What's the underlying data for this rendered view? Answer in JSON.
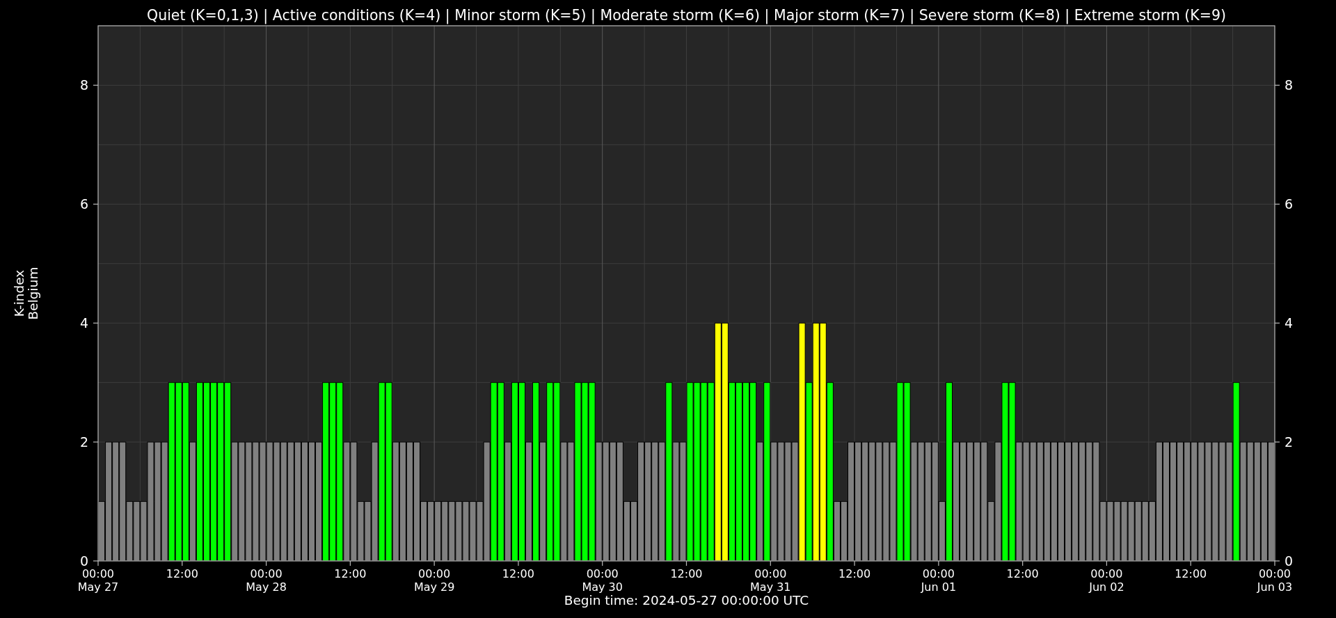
{
  "chart_data": {
    "type": "bar",
    "title": "Quiet (K=0,1,3) | Active conditions (K=4) | Minor storm (K=5) | Moderate storm (K=6) | Major storm (K=7) | Severe storm (K=8) | Extreme storm (K=9)",
    "xlabel": "Begin time: 2024-05-27 00:00:00 UTC",
    "ylabel": "K-index\nBelgium",
    "xlim": [
      "2024-05-27T00:00Z",
      "2024-06-03T00:00Z"
    ],
    "ylim": [
      0,
      9
    ],
    "yticks": [
      0,
      2,
      4,
      6,
      8
    ],
    "y2lim": [
      0,
      9
    ],
    "y2ticks": [
      0,
      2,
      4,
      6,
      8
    ],
    "grid": true,
    "xticks": [
      {
        "value": "2024-05-27T00:00Z",
        "label": "00:00\nMay 27"
      },
      {
        "value": "2024-05-27T12:00Z",
        "label": "12:00"
      },
      {
        "value": "2024-05-28T00:00Z",
        "label": "00:00\nMay 28"
      },
      {
        "value": "2024-05-28T12:00Z",
        "label": "12:00"
      },
      {
        "value": "2024-05-29T00:00Z",
        "label": "00:00\nMay 29"
      },
      {
        "value": "2024-05-29T12:00Z",
        "label": "12:00"
      },
      {
        "value": "2024-05-30T00:00Z",
        "label": "00:00\nMay 30"
      },
      {
        "value": "2024-05-30T12:00Z",
        "label": "12:00"
      },
      {
        "value": "2024-05-31T00:00Z",
        "label": "00:00\nMay 31"
      },
      {
        "value": "2024-05-31T12:00Z",
        "label": "12:00"
      },
      {
        "value": "2024-06-01T00:00Z",
        "label": "00:00\nJun 01"
      },
      {
        "value": "2024-06-01T12:00Z",
        "label": "12:00"
      },
      {
        "value": "2024-06-02T00:00Z",
        "label": "00:00\nJun 02"
      },
      {
        "value": "2024-06-02T12:00Z",
        "label": "12:00"
      },
      {
        "value": "2024-06-03T00:00Z",
        "label": "00:00\nJun 03"
      }
    ],
    "x": [
      "2024-05-27T00:00Z",
      "2024-05-27T01:00Z",
      "2024-05-27T02:00Z",
      "2024-05-27T03:00Z",
      "2024-05-27T04:00Z",
      "2024-05-27T05:00Z",
      "2024-05-27T06:00Z",
      "2024-05-27T07:00Z",
      "2024-05-27T08:00Z",
      "2024-05-27T09:00Z",
      "2024-05-27T10:00Z",
      "2024-05-27T11:00Z",
      "2024-05-27T12:00Z",
      "2024-05-27T13:00Z",
      "2024-05-27T14:00Z",
      "2024-05-27T15:00Z",
      "2024-05-27T16:00Z",
      "2024-05-27T17:00Z",
      "2024-05-27T18:00Z",
      "2024-05-27T19:00Z",
      "2024-05-27T20:00Z",
      "2024-05-27T21:00Z",
      "2024-05-27T22:00Z",
      "2024-05-27T23:00Z",
      "2024-05-28T00:00Z",
      "2024-05-28T01:00Z",
      "2024-05-28T02:00Z",
      "2024-05-28T03:00Z",
      "2024-05-28T04:00Z",
      "2024-05-28T05:00Z",
      "2024-05-28T06:00Z",
      "2024-05-28T07:00Z",
      "2024-05-28T08:00Z",
      "2024-05-28T09:00Z",
      "2024-05-28T10:00Z",
      "2024-05-28T11:00Z",
      "2024-05-28T12:00Z",
      "2024-05-28T13:00Z",
      "2024-05-28T14:00Z",
      "2024-05-28T15:00Z",
      "2024-05-28T16:00Z",
      "2024-05-28T17:00Z",
      "2024-05-28T18:00Z",
      "2024-05-28T19:00Z",
      "2024-05-28T20:00Z",
      "2024-05-28T21:00Z",
      "2024-05-28T22:00Z",
      "2024-05-28T23:00Z",
      "2024-05-29T00:00Z",
      "2024-05-29T01:00Z",
      "2024-05-29T02:00Z",
      "2024-05-29T03:00Z",
      "2024-05-29T04:00Z",
      "2024-05-29T05:00Z",
      "2024-05-29T06:00Z",
      "2024-05-29T07:00Z",
      "2024-05-29T08:00Z",
      "2024-05-29T09:00Z",
      "2024-05-29T10:00Z",
      "2024-05-29T11:00Z",
      "2024-05-29T12:00Z",
      "2024-05-29T13:00Z",
      "2024-05-29T14:00Z",
      "2024-05-29T15:00Z",
      "2024-05-29T16:00Z",
      "2024-05-29T17:00Z",
      "2024-05-29T18:00Z",
      "2024-05-29T19:00Z",
      "2024-05-29T20:00Z",
      "2024-05-29T21:00Z",
      "2024-05-29T22:00Z",
      "2024-05-29T23:00Z",
      "2024-05-30T00:00Z",
      "2024-05-30T01:00Z",
      "2024-05-30T02:00Z",
      "2024-05-30T03:00Z",
      "2024-05-30T04:00Z",
      "2024-05-30T05:00Z",
      "2024-05-30T06:00Z",
      "2024-05-30T07:00Z",
      "2024-05-30T08:00Z",
      "2024-05-30T09:00Z",
      "2024-05-30T10:00Z",
      "2024-05-30T11:00Z",
      "2024-05-30T12:00Z",
      "2024-05-30T13:00Z",
      "2024-05-30T14:00Z",
      "2024-05-30T15:00Z",
      "2024-05-30T16:00Z",
      "2024-05-30T17:00Z",
      "2024-05-30T18:00Z",
      "2024-05-30T19:00Z",
      "2024-05-30T20:00Z",
      "2024-05-30T21:00Z",
      "2024-05-30T22:00Z",
      "2024-05-30T23:00Z",
      "2024-05-31T00:00Z",
      "2024-05-31T01:00Z",
      "2024-05-31T02:00Z",
      "2024-05-31T03:00Z",
      "2024-05-31T04:00Z",
      "2024-05-31T05:00Z",
      "2024-05-31T06:00Z",
      "2024-05-31T07:00Z",
      "2024-05-31T08:00Z",
      "2024-05-31T09:00Z",
      "2024-05-31T10:00Z",
      "2024-05-31T11:00Z",
      "2024-05-31T12:00Z",
      "2024-05-31T13:00Z",
      "2024-05-31T14:00Z",
      "2024-05-31T15:00Z",
      "2024-05-31T16:00Z",
      "2024-05-31T17:00Z",
      "2024-05-31T18:00Z",
      "2024-05-31T19:00Z",
      "2024-05-31T20:00Z",
      "2024-05-31T21:00Z",
      "2024-05-31T22:00Z",
      "2024-05-31T23:00Z",
      "2024-06-01T00:00Z",
      "2024-06-01T01:00Z",
      "2024-06-01T02:00Z",
      "2024-06-01T03:00Z",
      "2024-06-01T04:00Z",
      "2024-06-01T05:00Z",
      "2024-06-01T06:00Z",
      "2024-06-01T07:00Z",
      "2024-06-01T08:00Z",
      "2024-06-01T09:00Z",
      "2024-06-01T10:00Z",
      "2024-06-01T11:00Z",
      "2024-06-01T12:00Z",
      "2024-06-01T13:00Z",
      "2024-06-01T14:00Z",
      "2024-06-01T15:00Z",
      "2024-06-01T16:00Z",
      "2024-06-01T17:00Z",
      "2024-06-01T18:00Z",
      "2024-06-01T19:00Z",
      "2024-06-01T20:00Z",
      "2024-06-01T21:00Z",
      "2024-06-01T22:00Z",
      "2024-06-01T23:00Z",
      "2024-06-02T00:00Z",
      "2024-06-02T01:00Z",
      "2024-06-02T02:00Z",
      "2024-06-02T03:00Z",
      "2024-06-02T04:00Z",
      "2024-06-02T05:00Z",
      "2024-06-02T06:00Z",
      "2024-06-02T07:00Z",
      "2024-06-02T08:00Z",
      "2024-06-02T09:00Z",
      "2024-06-02T10:00Z",
      "2024-06-02T11:00Z",
      "2024-06-02T12:00Z",
      "2024-06-02T13:00Z",
      "2024-06-02T14:00Z",
      "2024-06-02T15:00Z",
      "2024-06-02T16:00Z",
      "2024-06-02T17:00Z",
      "2024-06-02T18:00Z",
      "2024-06-02T19:00Z",
      "2024-06-02T20:00Z",
      "2024-06-02T21:00Z",
      "2024-06-02T22:00Z",
      "2024-06-02T23:00Z"
    ],
    "series": [
      {
        "values": [
          1,
          2,
          2,
          2,
          1,
          1,
          1,
          2,
          2,
          2,
          3,
          3,
          3,
          2,
          3,
          3,
          3,
          3,
          3,
          2,
          2,
          2,
          2,
          2,
          2,
          2,
          2,
          2,
          2,
          2,
          2,
          2,
          3,
          3,
          3,
          2,
          2,
          1,
          1,
          2,
          3,
          3,
          2,
          2,
          2,
          2,
          1,
          1,
          1,
          1,
          1,
          1,
          1,
          1,
          1,
          2,
          3,
          3,
          2,
          3,
          3,
          2,
          3,
          2,
          3,
          3,
          2,
          2,
          3,
          3,
          3,
          2,
          2,
          2,
          2,
          1,
          1,
          2,
          2,
          2,
          2,
          3,
          2,
          2,
          3,
          3,
          3,
          3,
          4,
          4,
          3,
          3,
          3,
          3,
          2,
          3,
          2,
          2,
          2,
          2,
          4,
          3,
          4,
          4,
          3,
          1,
          1,
          2,
          2,
          2,
          2,
          2,
          2,
          2,
          3,
          3,
          2,
          2,
          2,
          2,
          1,
          3,
          2,
          2,
          2,
          2,
          2,
          1,
          2,
          3,
          3,
          2,
          2,
          2,
          2,
          2,
          2,
          2,
          2,
          2,
          2,
          2,
          2,
          1,
          1,
          1,
          1,
          1,
          1,
          1,
          1,
          2,
          2,
          2,
          2,
          2,
          2,
          2,
          2,
          2,
          2,
          2,
          3,
          2,
          2,
          2,
          2,
          2
        ]
      }
    ]
  }
}
